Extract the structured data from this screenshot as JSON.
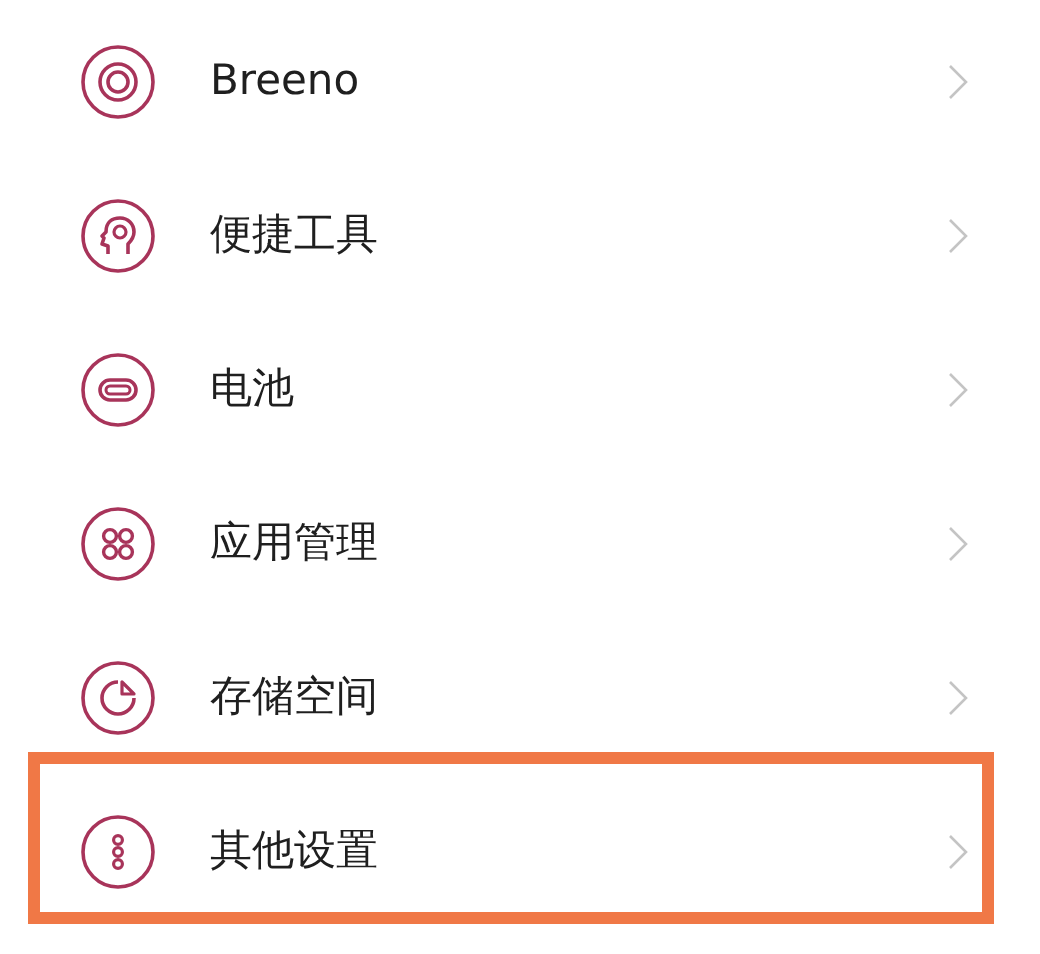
{
  "settings_items": [
    {
      "label": "Breeno",
      "highlighted": false
    },
    {
      "label": "便捷工具",
      "highlighted": false
    },
    {
      "label": "电池",
      "highlighted": false
    },
    {
      "label": "应用管理",
      "highlighted": false
    },
    {
      "label": "存储空间",
      "highlighted": false
    },
    {
      "label": "其他设置",
      "highlighted": true
    }
  ]
}
